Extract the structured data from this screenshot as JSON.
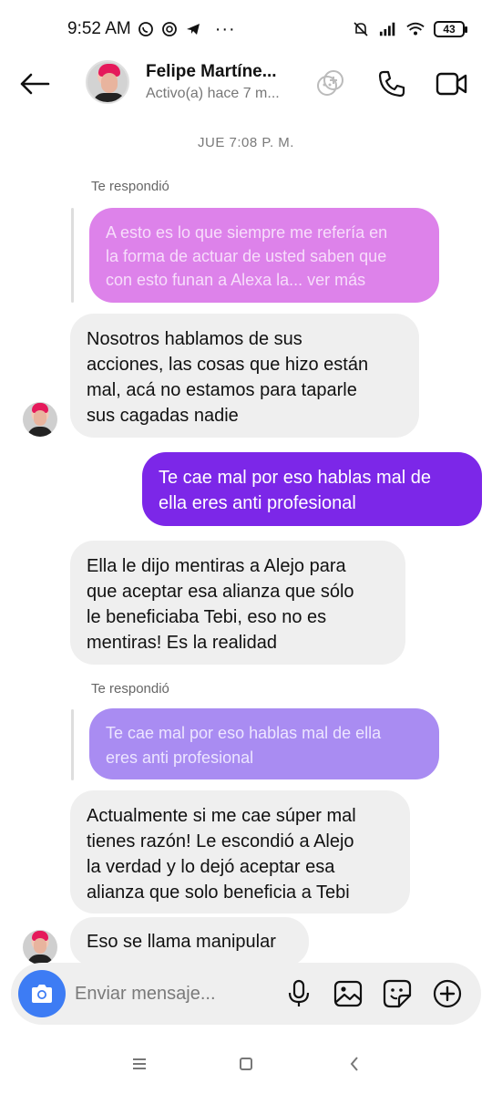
{
  "status_bar": {
    "time": "9:52 AM",
    "more_dots": "···",
    "battery": "43"
  },
  "header": {
    "contact_name": "Felipe Martíne...",
    "contact_status": "Activo(a) hace 7 m..."
  },
  "conversation": {
    "timestamp": "JUE 7:08 P. M.",
    "reply_label_1": "Te respondió",
    "quoted_1_lines": [
      "A esto es lo que siempre me refería en",
      "la forma de actuar de usted saben que",
      "con esto funan a Alexa la... ver más"
    ],
    "msg_1_lines": [
      "Nosotros hablamos de sus",
      "acciones, las cosas que hizo están",
      "mal, acá no estamos para taparle",
      "sus cagadas nadie"
    ],
    "sent_1_lines": [
      "Te cae mal por eso hablas mal de",
      "ella eres anti profesional"
    ],
    "msg_2_lines": [
      "Ella le dijo mentiras a Alejo para",
      "que aceptar esa alianza que sólo",
      "le beneficiaba Tebi, eso no es",
      "mentiras! Es la realidad"
    ],
    "reply_label_2": "Te respondió",
    "quoted_2_lines": [
      "Te cae mal por eso hablas mal de ella",
      "eres anti profesional"
    ],
    "msg_3_lines": [
      "Actualmente si me cae súper mal",
      "tienes razón! Le escondió a Alejo",
      "la verdad y lo dejó aceptar esa",
      "alianza que solo beneficia a Tebi"
    ],
    "msg_4_lines": [
      "Eso se llama manipular"
    ]
  },
  "composer": {
    "placeholder": "Enviar mensaje..."
  },
  "colors": {
    "sent_bubble": "#7c27e8",
    "received_bubble": "#efefef",
    "quoted_pink": "#dd82ea",
    "quoted_purple": "#a98cf2",
    "camera_button": "#3d7cf4"
  },
  "icons": {
    "back": "arrow-left-icon",
    "add_people": "add-people-icon",
    "call": "phone-icon",
    "video": "video-camera-icon",
    "camera": "camera-icon",
    "mic": "microphone-icon",
    "gallery": "image-icon",
    "sticker": "sticker-icon",
    "more": "plus-circle-icon"
  }
}
